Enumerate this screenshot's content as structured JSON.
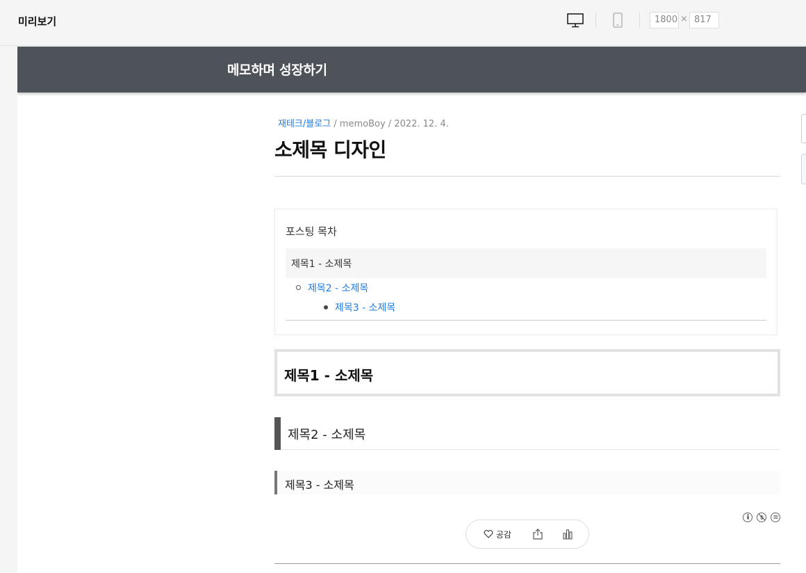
{
  "topbar": {
    "title": "미리보기",
    "width_value": "1800",
    "times": "×",
    "height_value": "817"
  },
  "blog": {
    "title": "메모하며 성장하기"
  },
  "post": {
    "category": "재테크/블로그",
    "sep1": " / ",
    "author": "memoBoy",
    "sep2": " / ",
    "date": "2022. 12. 4.",
    "title": "소제목 디자인"
  },
  "toc": {
    "title": "포스팅 목차",
    "items": [
      {
        "label": "제목1 - 소제목",
        "level": 1
      },
      {
        "label": "제목2 - 소제목",
        "level": 2
      },
      {
        "label": "제목3 - 소제목",
        "level": 3
      }
    ]
  },
  "headings": {
    "h1": "제목1 - 소제목",
    "h2": "제목2 - 소제목",
    "h3": "제목3 - 소제목"
  },
  "reactions": {
    "like_label": "공감"
  },
  "colors": {
    "header_bg": "#4d5359",
    "link": "#1e7be0"
  }
}
